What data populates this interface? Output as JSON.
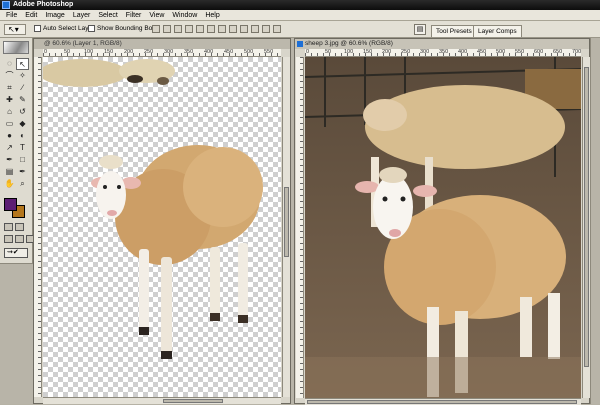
{
  "app": {
    "title": "Adobe Photoshop"
  },
  "menu": [
    "File",
    "Edit",
    "Image",
    "Layer",
    "Select",
    "Filter",
    "View",
    "Window",
    "Help"
  ],
  "options": {
    "tool_glyph": "↖▾",
    "auto_select_label": "Auto Select Layer",
    "bounding_box_label": "Show Bounding Box",
    "palette_well_glyph": "▤",
    "tab_tool_presets": "Tool Presets",
    "tab_layer_comps": "Layer Comps"
  },
  "toolbox": {
    "tools": [
      "marquee",
      "move",
      "lasso",
      "magic-wand",
      "crop",
      "slice",
      "healing-brush",
      "brush",
      "clone-stamp",
      "history-brush",
      "eraser",
      "paint-bucket",
      "blur",
      "dodge",
      "path-select",
      "type",
      "pen",
      "shape",
      "notes",
      "eyedropper",
      "hand",
      "zoom"
    ],
    "tool_glyphs": [
      "◌",
      "↖",
      "⌒",
      "✧",
      "⌗",
      "∕",
      "✚",
      "✎",
      "⌂",
      "↺",
      "▭",
      "◆",
      "●",
      "◐",
      "↗",
      "T",
      "✒",
      "□",
      "▤",
      "✒",
      "✋",
      "⌕"
    ],
    "foreground_color": "#5c1e73",
    "background_color": "#b3761c",
    "jump_glyph": "⇝✔"
  },
  "documents": {
    "left": {
      "title": "@ 60.6% (Layer 1, RGB/8)",
      "ruler_labels": [
        "0",
        "50",
        "100",
        "150",
        "200",
        "250",
        "300",
        "350",
        "400",
        "450",
        "500",
        "550"
      ]
    },
    "right": {
      "title": "sheep 3.jpg @ 60.6% (RGB/8)",
      "ruler_labels": [
        "0",
        "50",
        "100",
        "150",
        "200",
        "250",
        "300",
        "350",
        "400",
        "450",
        "500",
        "550",
        "600",
        "650",
        "700"
      ]
    }
  }
}
